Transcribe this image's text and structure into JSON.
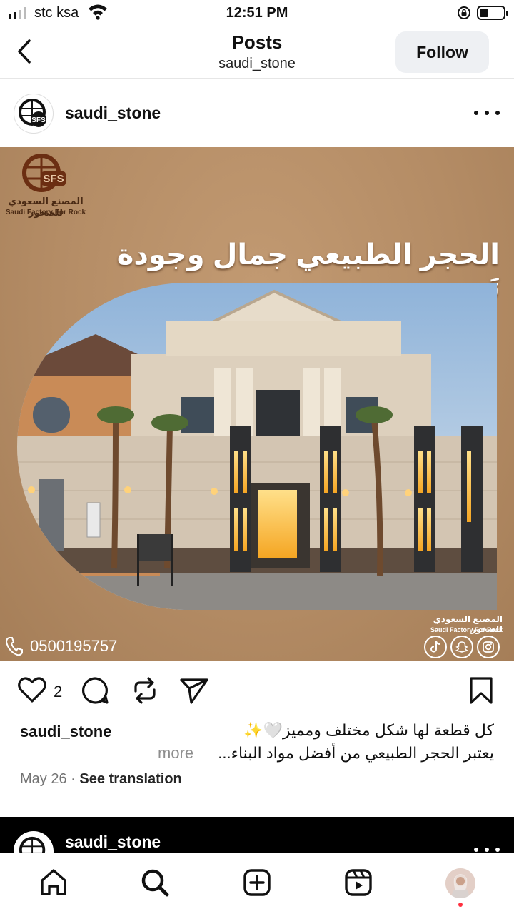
{
  "status_bar": {
    "carrier": "stc ksa",
    "time": "12:51 PM",
    "icons": [
      "signal-icon",
      "wifi-icon",
      "rotation-lock-icon",
      "battery-icon"
    ]
  },
  "header": {
    "title": "Posts",
    "subtitle": "saudi_stone",
    "follow_label": "Follow",
    "back_icon": "chevron-left-icon"
  },
  "post": {
    "username": "saudi_stone",
    "avatar_logo": "SFS",
    "image": {
      "brand_logo": "SFS",
      "brand_name_ar": "المصنع السعودي للصخور",
      "brand_name_en": "Saudi Factory For Rock",
      "headline": "الحجر الطبيعي جمال وجودة تَدوم",
      "phone": "0500195757",
      "footer_brand_ar": "المصنع السعودي للصخور",
      "footer_brand_en": "Saudi Factory For Rock",
      "social_icons": [
        "tiktok-icon",
        "snapchat-icon",
        "instagram-icon"
      ]
    },
    "like_count": "2",
    "caption_line1": "كل قطعة لها شكل مختلف ومميز🤍✨",
    "caption_line2": "يعتبر الحجر الطبيعي من أفضل مواد البناء...",
    "more_label": "more",
    "date": "May 26",
    "separator": "·",
    "see_translation": "See translation"
  },
  "next_post": {
    "username": "saudi_stone"
  },
  "tab_bar": {
    "tabs": [
      "home-icon",
      "search-icon",
      "create-icon",
      "reels-icon",
      "profile-avatar"
    ]
  },
  "colors": {
    "image_background": "#b48c65",
    "brand_brown": "#4a2a14",
    "follow_button_bg": "#eef0f3",
    "notification_dot": "#ff3040"
  }
}
